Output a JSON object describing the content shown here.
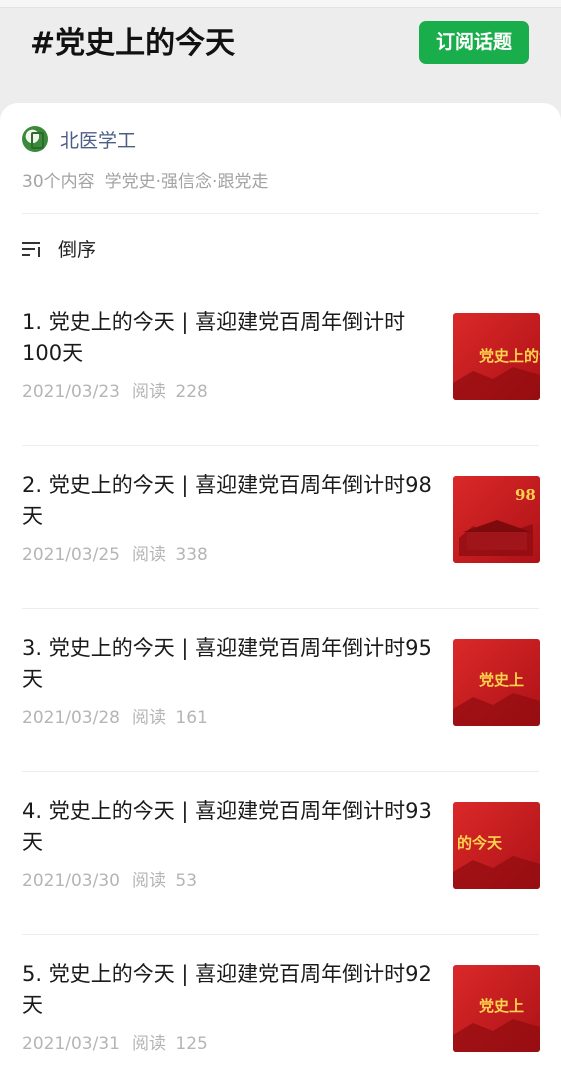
{
  "header": {
    "topic_title": "#党史上的今天",
    "subscribe_label": "订阅话题"
  },
  "account": {
    "name": "北医学工",
    "content_count": "30个内容",
    "slogan": "学党史·强信念·跟党走"
  },
  "sort": {
    "label": "倒序"
  },
  "articles": [
    {
      "title": "1. 党史上的今天 | 喜迎建党百周年倒计时100天",
      "date": "2021/03/23",
      "read_label": "阅读",
      "read_count": "228",
      "thumb_text": "党史上的今"
    },
    {
      "title": "2. 党史上的今天 | 喜迎建党百周年倒计时98天",
      "date": "2021/03/25",
      "read_label": "阅读",
      "read_count": "338",
      "thumb_text": "98"
    },
    {
      "title": "3. 党史上的今天 | 喜迎建党百周年倒计时95天",
      "date": "2021/03/28",
      "read_label": "阅读",
      "read_count": "161",
      "thumb_text": "党史上"
    },
    {
      "title": "4. 党史上的今天 | 喜迎建党百周年倒计时93天",
      "date": "2021/03/30",
      "read_label": "阅读",
      "read_count": "53",
      "thumb_text": "的今天"
    },
    {
      "title": "5. 党史上的今天 | 喜迎建党百周年倒计时92天",
      "date": "2021/03/31",
      "read_label": "阅读",
      "read_count": "125",
      "thumb_text": "党史上"
    }
  ],
  "colors": {
    "accent_green": "#1aad4b",
    "account_name": "#4d5e84",
    "thumb_red": "#c8161d",
    "thumb_gold": "#ffd34d"
  }
}
